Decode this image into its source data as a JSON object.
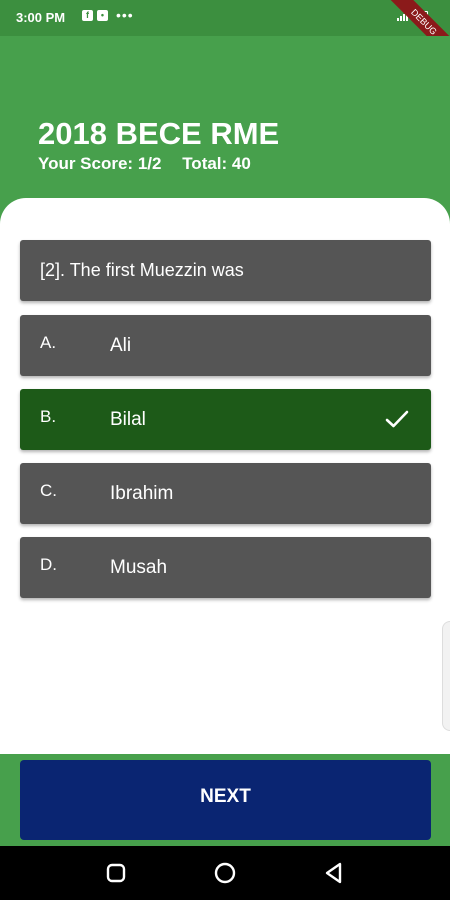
{
  "status_bar": {
    "time": "3:00 PM",
    "notification_icons": [
      "facebook-icon",
      "message-icon"
    ],
    "more": "•••",
    "debug_banner": "DEBUG"
  },
  "quiz": {
    "title": "2018 BECE RME",
    "score_label": "Your Score: 1/2",
    "total_label": "Total: 40"
  },
  "question": {
    "text": "[2]. The first Muezzin was"
  },
  "options": [
    {
      "letter": "A.",
      "text": "Ali",
      "state": "normal"
    },
    {
      "letter": "B.",
      "text": "Bilal",
      "state": "correct"
    },
    {
      "letter": "C.",
      "text": "Ibrahim",
      "state": "normal"
    },
    {
      "letter": "D.",
      "text": "Musah",
      "state": "normal"
    }
  ],
  "footer": {
    "next_label": "NEXT"
  },
  "colors": {
    "header_green": "#47a04c",
    "option_gray": "#555555",
    "correct_green": "#1d5a18",
    "next_blue": "#0a2572"
  }
}
